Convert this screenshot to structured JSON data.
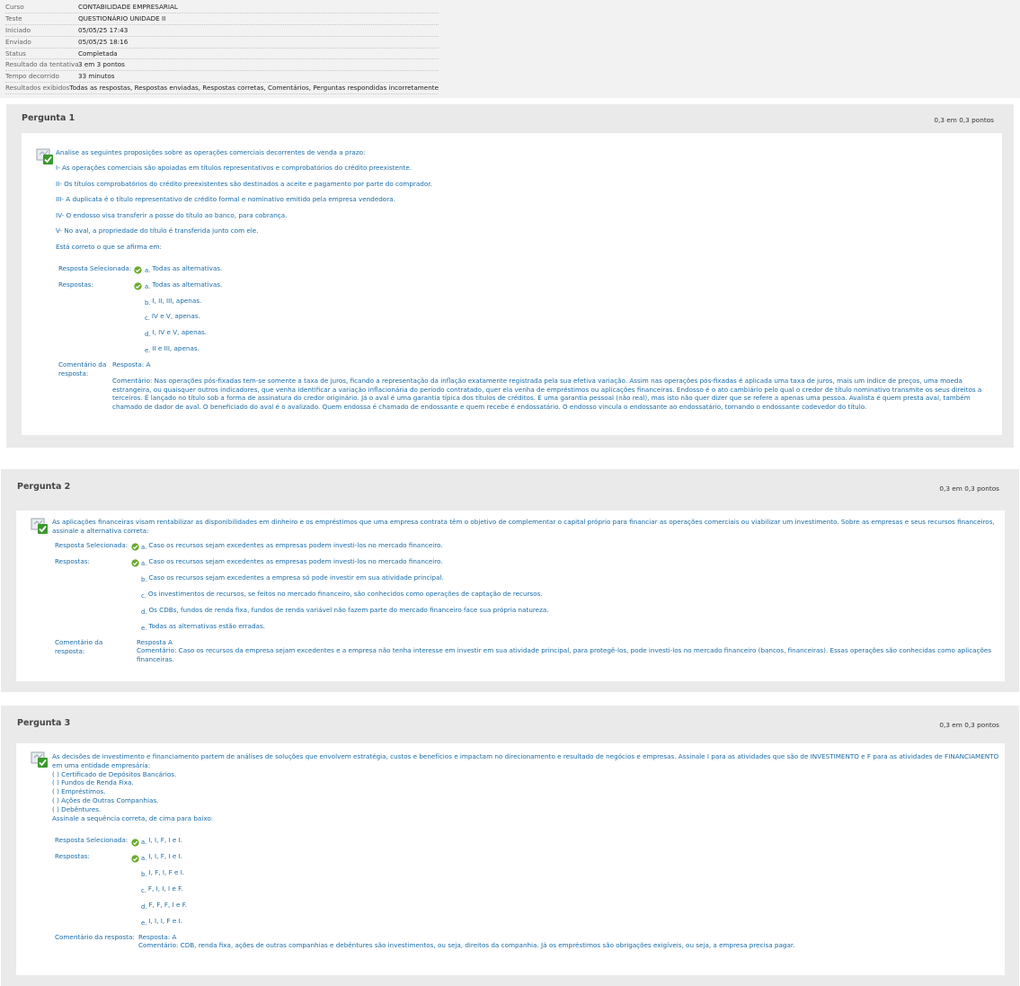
{
  "summary": {
    "rows": [
      {
        "label": "Curso",
        "value": "CONTABILIDADE EMPRESARIAL"
      },
      {
        "label": "Teste",
        "value": "QUESTIONÁRIO UNIDADE II"
      },
      {
        "label": "Iniciado",
        "value": "05/05/25 17:43"
      },
      {
        "label": "Enviado",
        "value": "05/05/25 18:16"
      },
      {
        "label": "Status",
        "value": "Completada"
      },
      {
        "label": "Resultado da tentativa",
        "value": "3 em 3 pontos"
      },
      {
        "label": "Tempo decorrido",
        "value": "33 minutos"
      },
      {
        "label": "Resultados exibidos",
        "value": "Todas as respostas, Respostas enviadas, Respostas corretas, Comentários, Perguntas respondidas incorretamente"
      }
    ]
  },
  "labels": {
    "selected": "Resposta Selecionada:",
    "answers": "Respostas:",
    "comment_a": "Comentário da",
    "comment_b": "resposta:",
    "comment_full": "Comentário da resposta:"
  },
  "questions": [
    {
      "title": "Pergunta 1",
      "points": "0,3 em 0,3 pontos",
      "stem": [
        "Analise as seguintes proposições sobre as operações comerciais decorrentes de venda a prazo:",
        "I- As operações comerciais são apoiadas em títulos representativos e comprobatórios do crédito preexistente.",
        "II- Os títulos comprobatórios do crédito preexistentes são destinados a aceite e pagamento por parte do comprador.",
        "III- A duplicata é o título representativo de crédito formal e nominativo emitido pela empresa vendedora.",
        "IV- O endosso visa transferir a posse do título ao banco, para cobrança.",
        "V- No aval, a propriedade do título é transferida junto com ele.",
        "Está correto o que se afirma em:"
      ],
      "selected": {
        "letter": "a.",
        "text": "Todas as alternativas."
      },
      "answers": [
        {
          "letter": "a.",
          "text": "Todas as alternativas."
        },
        {
          "letter": "b.",
          "text": "I, II, III, apenas."
        },
        {
          "letter": "c.",
          "text": "IV e V, apenas."
        },
        {
          "letter": "d.",
          "text": "I, IV e V, apenas."
        },
        {
          "letter": "e.",
          "text": "II e III, apenas."
        }
      ],
      "comment_answer": "Resposta: A",
      "comment_lines": [
        "Comentário: Nas operações pós-fixadas tem-se somente a taxa de juros, ficando a representação da inflação exatamente registrada pela sua efetiva variação. Assim nas operações pós-fixadas é aplicada uma taxa de juros, mais um índice de preços, uma moeda",
        "estrangeira, ou quaisquer outros indicadores, que venha identificar a variação inflacionária do período contratado, quer ela venha de empréstimos ou aplicações financeiras. Endosso é o ato cambiário pelo qual o credor de título nominativo transmite os seus direitos a",
        "terceiros. É lançado no título sob a forma de assinatura do credor originário. Já o aval é uma garantia típica dos títulos de créditos. É uma garantia pessoal (não real), mas isto não quer dizer que se refere a apenas uma pessoa. Avalista é quem presta aval, também",
        "chamado de dador de aval. O beneficiado do aval é o avalizado. Quem endossa é chamado de endossante e quem recebe é endossatário. O endosso vincula o endossante ao endossatário, tornando o endossante codevedor do título."
      ]
    },
    {
      "title": "Pergunta 2",
      "points": "0,3 em 0,3 pontos",
      "stem": [
        "As aplicações financeiras visam rentabilizar as disponibilidades em dinheiro e os empréstimos que uma empresa contrata têm o objetivo de complementar o capital próprio para financiar as operações comerciais ou viabilizar um investimento. Sobre as empresas e seus recursos financeiros,",
        "assinale a alternativa correta:"
      ],
      "selected": {
        "letter": "a.",
        "text": "Caso os recursos sejam excedentes as empresas podem investi-los no mercado financeiro."
      },
      "answers": [
        {
          "letter": "a.",
          "text": "Caso os recursos sejam excedentes as empresas podem investi-los no mercado financeiro."
        },
        {
          "letter": "b.",
          "text": "Caso os recursos sejam excedentes a empresa só pode investir em sua atividade principal."
        },
        {
          "letter": "c.",
          "text": "Os investimentos de recursos, se feitos no mercado financeiro, são conhecidos como operações de captação de recursos."
        },
        {
          "letter": "d.",
          "text": "Os CDBs, fundos de renda fixa, fundos de renda variável não fazem parte do mercado financeiro face sua própria natureza."
        },
        {
          "letter": "e.",
          "text": "Todas as alternativas estão erradas."
        }
      ],
      "comment_answer": "Resposta A",
      "comment_lines": [
        "Comentário: Caso os recursos da empresa sejam excedentes e a empresa não tenha interesse em investir em sua atividade principal, para protegê-los, pode investi-los no mercado financeiro (bancos, financeiras). Essas operações são conhecidas como aplicações",
        "financeiras."
      ]
    },
    {
      "title": "Pergunta 3",
      "points": "0,3 em 0,3 pontos",
      "stem": [
        "As decisões de investimento e financiamento partem de análises de soluções que envolvem estratégia, custos e benefícios e impactam no direcionamento e resultado de negócios e empresas. Assinale I para as atividades que são de INVESTIMENTO e F para as atividades de FINANCIAMENTO",
        "em uma entidade empresária:",
        "( ) Certificado de Depósitos Bancários.",
        "( ) Fundos de Renda Fixa.",
        "( ) Empréstimos.",
        "( ) Ações de Outras Companhias.",
        "( ) Debêntures.",
        "Assinale a sequência correta, de cima para baixo:"
      ],
      "selected": {
        "letter": "a.",
        "text": "I, I, F, I e I."
      },
      "answers": [
        {
          "letter": "a.",
          "text": "I, I, F, I e I."
        },
        {
          "letter": "b.",
          "text": "I, F, I, F e I."
        },
        {
          "letter": "c.",
          "text": "F, I, I, I e F."
        },
        {
          "letter": "d.",
          "text": "F, F, F, I e F."
        },
        {
          "letter": "e.",
          "text": "I, I, I, F e I."
        }
      ],
      "comment_answer": "Resposta: A",
      "comment_lines": [
        "Comentário: CDB, renda fixa, ações de outras companhias e debêntures são investimentos, ou seja, direitos da companhia. Já os empréstimos são obrigações exigíveis, ou seja, a empresa precisa pagar."
      ]
    }
  ]
}
